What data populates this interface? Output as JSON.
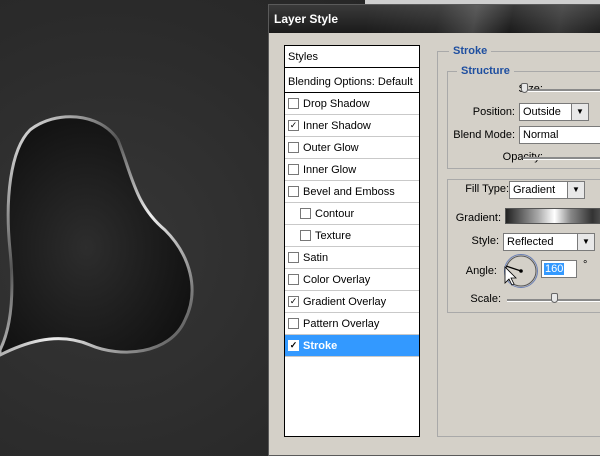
{
  "dialog": {
    "title": "Layer Style"
  },
  "styles_panel": {
    "header": "Styles",
    "blending": "Blending Options: Default",
    "items": [
      {
        "label": "Drop Shadow",
        "checked": false
      },
      {
        "label": "Inner Shadow",
        "checked": true
      },
      {
        "label": "Outer Glow",
        "checked": false
      },
      {
        "label": "Inner Glow",
        "checked": false
      },
      {
        "label": "Bevel and Emboss",
        "checked": false
      },
      {
        "label": "Contour",
        "checked": false
      },
      {
        "label": "Texture",
        "checked": false
      },
      {
        "label": "Satin",
        "checked": false
      },
      {
        "label": "Color Overlay",
        "checked": false
      },
      {
        "label": "Gradient Overlay",
        "checked": true
      },
      {
        "label": "Pattern Overlay",
        "checked": false
      },
      {
        "label": "Stroke",
        "checked": true,
        "selected": true
      }
    ],
    "check_mark": "✓"
  },
  "stroke": {
    "title": "Stroke",
    "structure_title": "Structure",
    "size_label": "Size:",
    "position_label": "Position:",
    "position_value": "Outside",
    "blend_mode_label": "Blend Mode:",
    "blend_mode_value": "Normal",
    "opacity_label": "Opacity:",
    "fill_type_label": "Fill Type:",
    "fill_type_value": "Gradient",
    "gradient_label": "Gradient:",
    "style_label": "Style:",
    "style_value": "Reflected",
    "angle_label": "Angle:",
    "angle_value": "160",
    "angle_unit": "°",
    "scale_label": "Scale:",
    "dropdown_arrow": "▼"
  },
  "colors": {
    "selection": "#3399ff",
    "group_title": "#1f4fa0",
    "dialog_bg": "#d4d0c8"
  }
}
